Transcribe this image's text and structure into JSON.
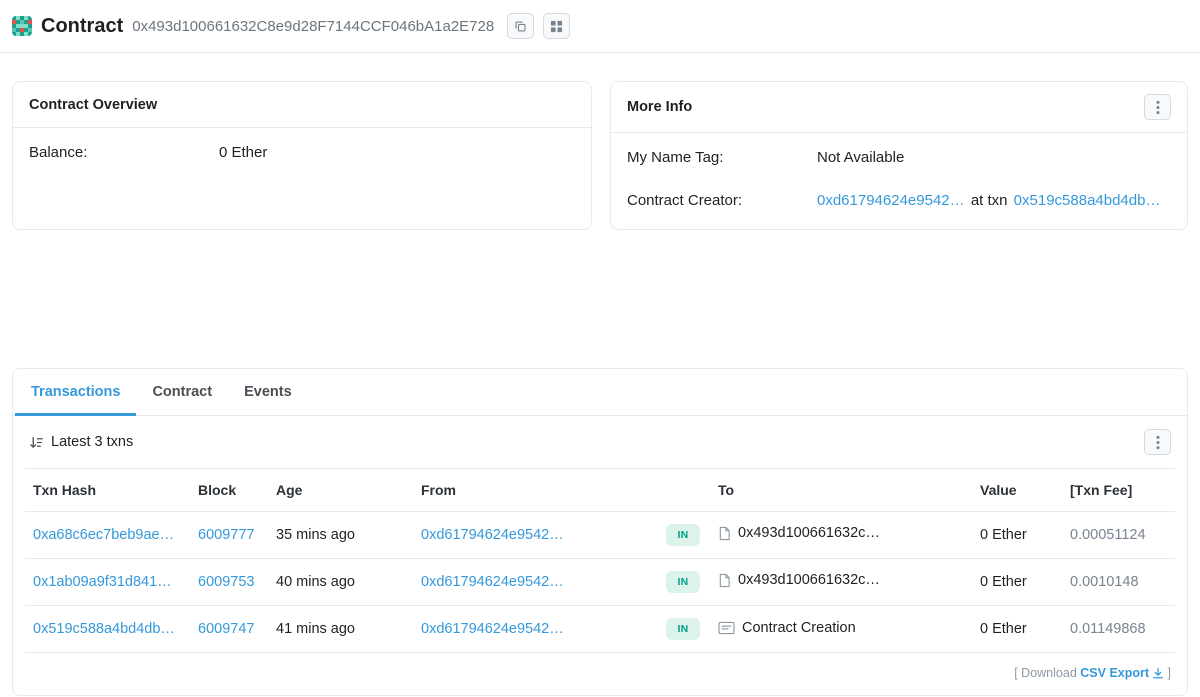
{
  "colors": {
    "link": "#3498db",
    "border": "#e7eaf3",
    "in_badge_bg": "#dcf3ec",
    "in_badge_text": "#00a186"
  },
  "page": {
    "title": "Contract",
    "address": "0x493d100661632C8e9d28F7144CCF046bA1a2E728",
    "icons": {
      "avatar": "blockies-avatar",
      "copy": "copy-icon",
      "grid": "grid-icon"
    }
  },
  "overview": {
    "title": "Contract Overview",
    "balance_label": "Balance:",
    "balance_value": "0 Ether"
  },
  "more_info": {
    "title": "More Info",
    "name_tag_label": "My Name Tag:",
    "name_tag_value": "Not Available",
    "creator_label": "Contract Creator:",
    "creator_address": "0xd61794624e9542…",
    "creator_connector": "at txn",
    "creator_txn": "0x519c588a4bd4db…"
  },
  "transactions": {
    "tabs": [
      {
        "label": "Transactions"
      },
      {
        "label": "Contract"
      },
      {
        "label": "Events"
      }
    ],
    "latest_label": "Latest 3 txns",
    "table": {
      "headers": {
        "txn_hash": "Txn Hash",
        "block": "Block",
        "age": "Age",
        "from": "From",
        "direction": "",
        "to": "To",
        "value": "Value",
        "txn_fee": "[Txn Fee]"
      },
      "rows": [
        {
          "txn_hash": "0xa68c6ec7beb9ae…",
          "block": "6009777",
          "age": "35 mins ago",
          "from": "0xd61794624e9542…",
          "direction": "IN",
          "to": "0x493d100661632c…",
          "to_icon": "document-icon",
          "value": "0 Ether",
          "txn_fee": "0.00051124"
        },
        {
          "txn_hash": "0x1ab09a9f31d841…",
          "block": "6009753",
          "age": "40 mins ago",
          "from": "0xd61794624e9542…",
          "direction": "IN",
          "to": "0x493d100661632c…",
          "to_icon": "document-icon",
          "value": "0 Ether",
          "txn_fee": "0.0010148"
        },
        {
          "txn_hash": "0x519c588a4bd4db…",
          "block": "6009747",
          "age": "41 mins ago",
          "from": "0xd61794624e9542…",
          "direction": "IN",
          "to": "Contract Creation",
          "to_icon": "contract-creation-icon",
          "value": "0 Ether",
          "txn_fee": "0.01149868"
        }
      ]
    },
    "footer": {
      "prefix": "[ Download",
      "csv_label": "CSV Export",
      "suffix": "]"
    }
  }
}
